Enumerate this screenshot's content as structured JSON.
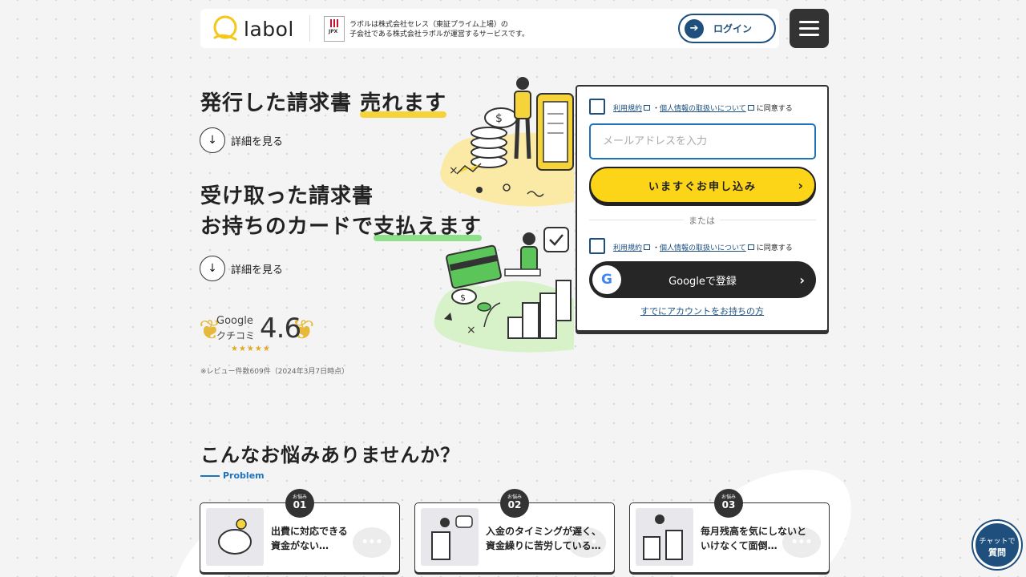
{
  "header": {
    "logo_text": "labol",
    "jpx_label": "JPX",
    "corp_line1": "ラボルは株式会社セレス（東証プライム上場）の",
    "corp_line2": "子会社である株式会社ラボルが運営するサービスです。",
    "login_label": "ログイン",
    "login_icon": "login-arrow-icon",
    "menu_icon": "hamburger-icon"
  },
  "hero": {
    "block1": {
      "plain": "発行した請求書 ",
      "highlight": "売れます",
      "detail": "詳細を見る"
    },
    "block2": {
      "line1": "受け取った請求書",
      "plain": "お持ちのカードで",
      "highlight": "支払えます",
      "detail": "詳細を見る"
    },
    "rating": {
      "brand": "Google",
      "label": "クチコミ",
      "value": "4.6",
      "stars": 4.5,
      "note": "※レビュー件数609件（2024年3月7日時点）"
    }
  },
  "form": {
    "terms1": {
      "link1": "利用規約",
      "sep": "・",
      "link2": "個人情報の取扱いについて",
      "suffix": "に同意する"
    },
    "email_placeholder": "メールアドレスを入力",
    "apply_label": "いますぐお申し込み",
    "or_label": "または",
    "terms2": {
      "link1": "利用規約",
      "sep": "・",
      "link2": "個人情報の取扱いについて",
      "suffix": "に同意する"
    },
    "google_label": "Googleで登録",
    "have_account": "すでにアカウントをお持ちの方"
  },
  "problems": {
    "title": "こんなお悩みありませんか？",
    "subtitle": "Problem",
    "badge_label": "お悩み",
    "items": [
      {
        "num": "01",
        "line1": "出費に対応できる",
        "line2": "資金がない…"
      },
      {
        "num": "02",
        "line1": "入金のタイミングが遅く、",
        "line2": "資金繰りに苦労している…"
      },
      {
        "num": "03",
        "line1": "毎月残高を気にしないと",
        "line2": "いけなくて面倒…"
      }
    ]
  },
  "chat": {
    "line1": "チャットで",
    "line2": "質問"
  },
  "colors": {
    "accent_blue": "#1e4f7d",
    "highlight_yellow": "#fcd518",
    "highlight_green": "#8ee08a",
    "dark": "#262626"
  }
}
